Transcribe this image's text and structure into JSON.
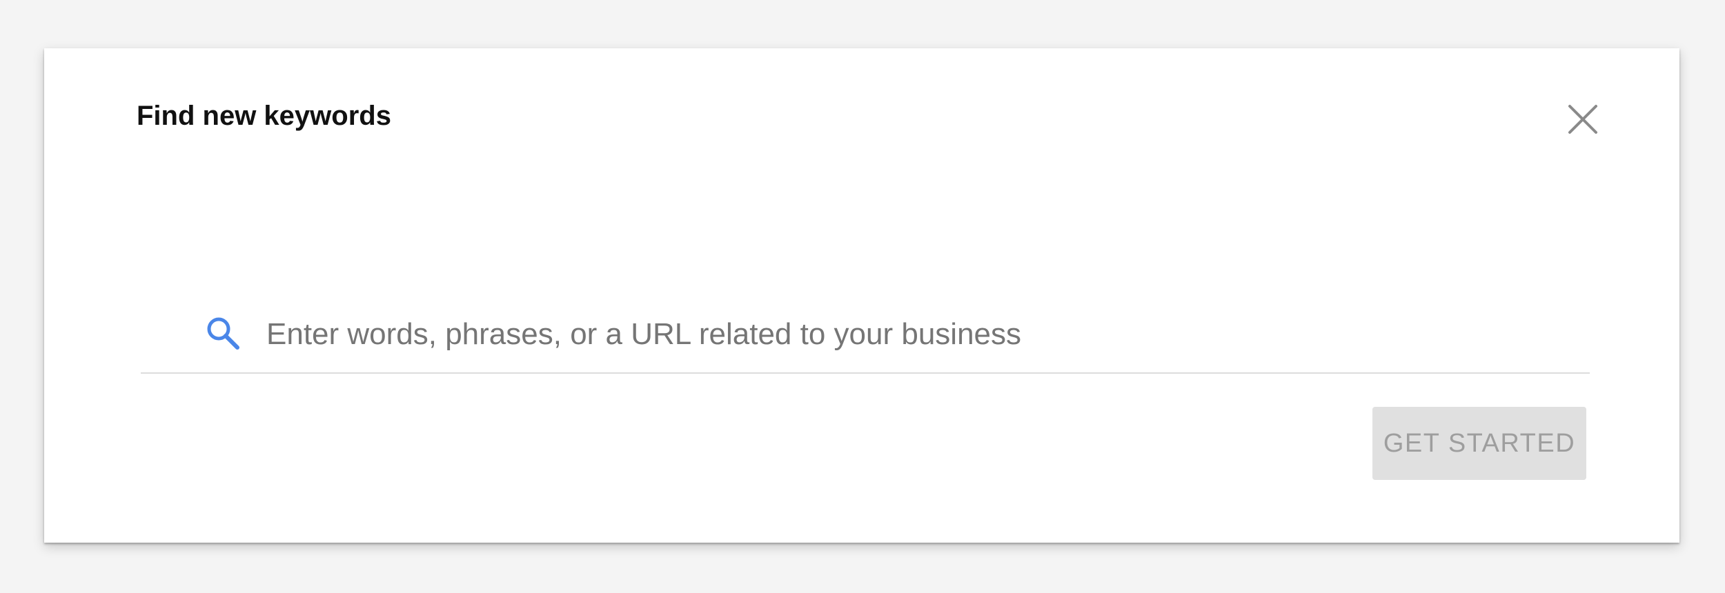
{
  "dialog": {
    "title": "Find new keywords",
    "close_icon": "close-icon"
  },
  "search": {
    "icon": "search-icon",
    "value": "",
    "placeholder": "Enter words, phrases, or a URL related to your business"
  },
  "actions": {
    "get_started_label": "GET STARTED",
    "get_started_state": "disabled"
  },
  "colors": {
    "page_background": "#f4f4f4",
    "dialog_background": "#ffffff",
    "search_icon": "#4a86e8",
    "close_icon": "#8a8a8a",
    "button_background_disabled": "#e0e0e0",
    "button_text_disabled": "#9e9e9e"
  }
}
